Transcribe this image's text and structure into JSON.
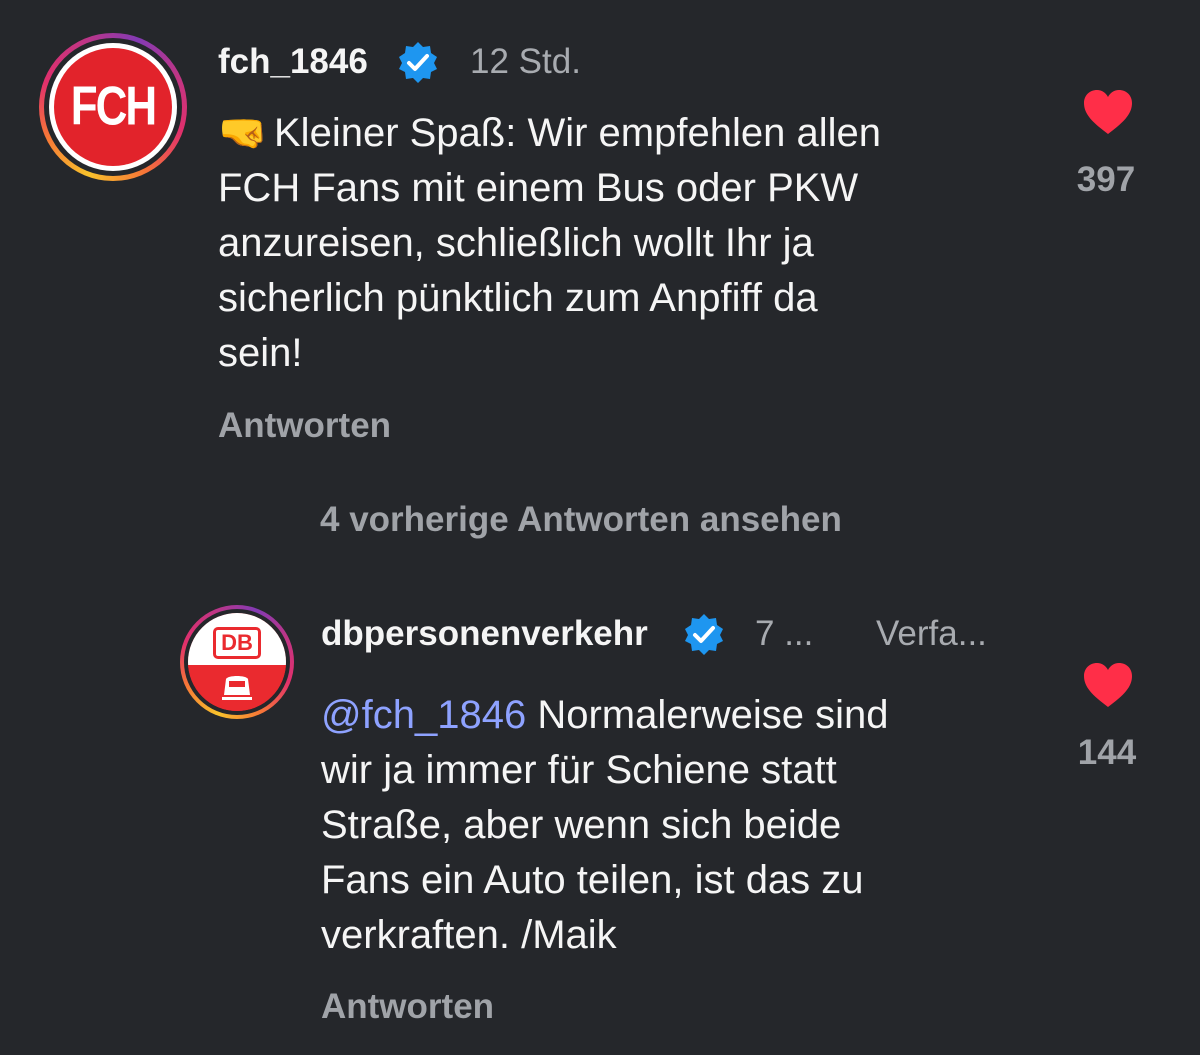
{
  "comment": {
    "avatar_text": "FCH",
    "username": "fch_1846",
    "time": "12 Std.",
    "emoji": "🤜",
    "text_lines": [
      "Kleiner Spaß: Wir empfehlen allen",
      "FCH Fans mit einem Bus oder PKW",
      "anzureisen, schließlich wollt Ihr ja",
      "sicherlich pünktlich zum Anpfiff da",
      "sein!"
    ],
    "likes": "397",
    "reply_label": "Antworten"
  },
  "view_previous": "4 vorherige Antworten ansehen",
  "reply": {
    "avatar_text": "DB",
    "username": "dbpersonenverkehr",
    "time": "7 ...",
    "author_label": "Verfa...",
    "mention": "@fch_1846",
    "text_lines": [
      " Normalerweise sind",
      "wir ja immer für Schiene statt",
      "Straße, aber wenn sich beide",
      "Fans ein Auto teilen, ist das zu",
      "verkraften. /Maik"
    ],
    "likes": "144",
    "reply_label": "Antworten"
  },
  "colors": {
    "background": "#25272b",
    "heart": "#ff2e48",
    "verified": "#1e96f0",
    "mention": "#8ea2ff",
    "fch_red": "#e2232b",
    "db_red": "#ea2a2f"
  },
  "icons": {
    "verified": "verified-badge-icon",
    "like": "heart-icon"
  }
}
